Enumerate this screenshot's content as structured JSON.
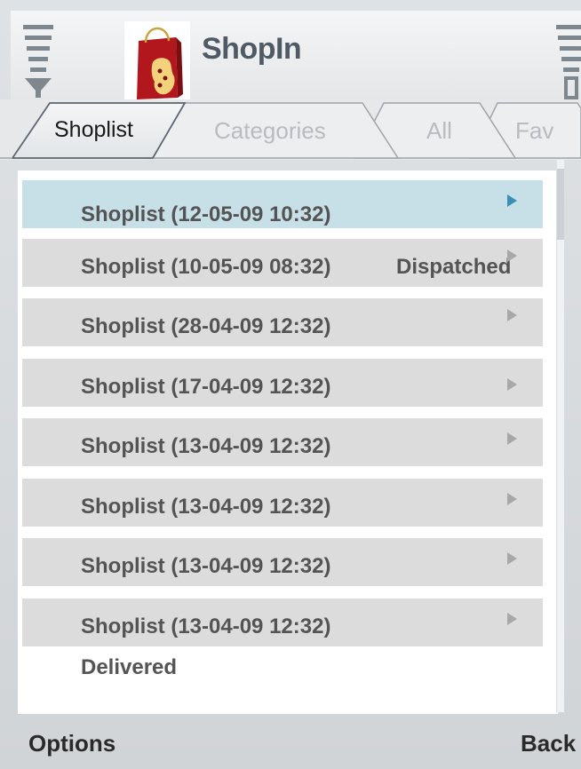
{
  "app": {
    "title": "ShopIn"
  },
  "tabs": [
    {
      "label": "Shoplist",
      "active": true
    },
    {
      "label": "Categories",
      "active": false
    },
    {
      "label": "All",
      "active": false
    },
    {
      "label": "Fav",
      "active": false
    }
  ],
  "shoplists": [
    {
      "label": "Shoplist (12-05-09 10:32)",
      "status": "",
      "selected": true
    },
    {
      "label": "Shoplist (10-05-09 08:32)",
      "status": "Dispatched",
      "selected": false
    },
    {
      "label": "Shoplist (28-04-09 12:32)",
      "status": "",
      "selected": false
    },
    {
      "label": "Shoplist (17-04-09 12:32)",
      "status": "",
      "selected": false
    },
    {
      "label": "Shoplist (13-04-09 12:32)",
      "status": "",
      "selected": false
    },
    {
      "label": "Shoplist (13-04-09 12:32)",
      "status": "",
      "selected": false
    },
    {
      "label": "Shoplist (13-04-09 12:32)",
      "status": "",
      "selected": false
    },
    {
      "label": "Shoplist (13-04-09 12:32)",
      "status": "",
      "selected": false
    }
  ],
  "footer_status": "Delivered",
  "softkeys": {
    "left": "Options",
    "right": "Back"
  },
  "icons": {
    "signal": "signal-strength-icon",
    "battery": "battery-icon",
    "logo": "shopping-bag-logo",
    "item_arrow": "chevron-right-icon"
  },
  "colors": {
    "selected_row": "#c7dfe7",
    "row": "#dcdcdc",
    "text": "#545454",
    "selected_arrow": "#3a8fb5"
  }
}
